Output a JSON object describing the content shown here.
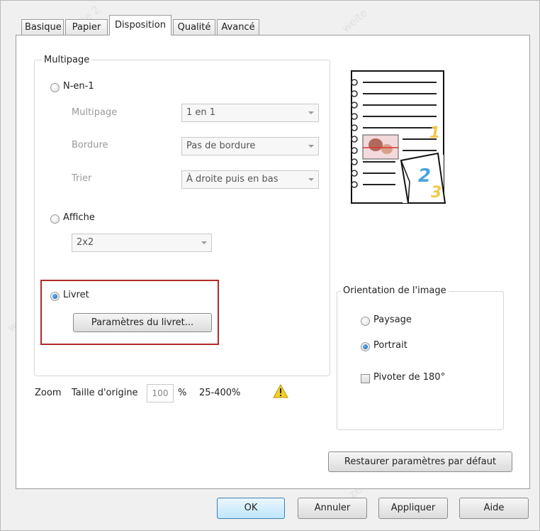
{
  "tabs": [
    "Basique",
    "Papier",
    "Disposition",
    "Qualité",
    "Avancé"
  ],
  "multipage_group": {
    "title": "Multipage",
    "nup_radio": "N-en-1",
    "multipage_label": "Multipage",
    "multipage_value": "1 en 1",
    "border_label": "Bordure",
    "border_value": "Pas de bordure",
    "sort_label": "Trier",
    "sort_value": "À droite puis en bas",
    "poster_radio": "Affiche",
    "poster_value": "2x2",
    "booklet_radio": "Livret",
    "booklet_button": "Paramètres du livret...",
    "selected": "Livret"
  },
  "zoom": {
    "label": "Zoom",
    "sub_label": "Taille d'origine",
    "value": "100",
    "unit": "%",
    "range": "25-400%"
  },
  "orientation_group": {
    "title": "Orientation de l'image",
    "landscape": "Paysage",
    "portrait": "Portrait",
    "rotate": "Pivoter de 180°",
    "selected": "Portrait",
    "rotate_checked": false
  },
  "preview": {
    "page_numbers": [
      "1",
      "2",
      "3"
    ],
    "accent_yellow": "#f2c94c",
    "accent_blue": "#4aa3e0"
  },
  "buttons": {
    "restore": "Restaurer paramètres par défaut",
    "ok": "OK",
    "cancel": "Annuler",
    "apply": "Appliquer",
    "help": "Aide"
  },
  "colors": {
    "highlight": "#b22a2a"
  }
}
